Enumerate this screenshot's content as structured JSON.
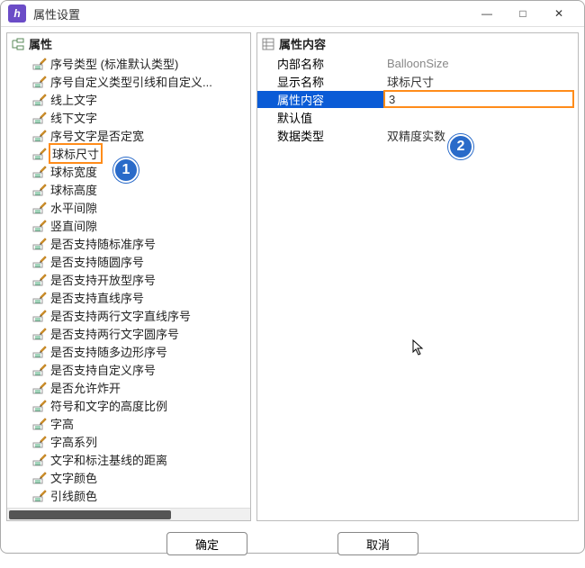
{
  "window": {
    "title": "属性设置",
    "minimize": "—",
    "maximize": "□",
    "close": "✕"
  },
  "left": {
    "header": "属性",
    "items": [
      {
        "label": "序号类型 (标准默认类型)"
      },
      {
        "label": "序号自定义类型引线和自定义..."
      },
      {
        "label": "线上文字"
      },
      {
        "label": "线下文字"
      },
      {
        "label": "序号文字是否定宽"
      },
      {
        "label": "球标尺寸",
        "highlighted": true
      },
      {
        "label": "球标宽度"
      },
      {
        "label": "球标高度"
      },
      {
        "label": "水平间隙"
      },
      {
        "label": "竖直间隙"
      },
      {
        "label": "是否支持随标准序号"
      },
      {
        "label": "是否支持随圆序号"
      },
      {
        "label": "是否支持开放型序号"
      },
      {
        "label": "是否支持直线序号"
      },
      {
        "label": "是否支持两行文字直线序号"
      },
      {
        "label": "是否支持两行文字圆序号"
      },
      {
        "label": "是否支持随多边形序号"
      },
      {
        "label": "是否支持自定义序号"
      },
      {
        "label": "是否允许炸开"
      },
      {
        "label": "符号和文字的高度比例"
      },
      {
        "label": "字高"
      },
      {
        "label": "字高系列"
      },
      {
        "label": "文字和标注基线的距离"
      },
      {
        "label": "文字颜色"
      },
      {
        "label": "引线颜色"
      }
    ]
  },
  "right": {
    "header": "属性内容",
    "rows": [
      {
        "key": "内部名称",
        "val": "BalloonSize",
        "grey": true
      },
      {
        "key": "显示名称",
        "val": "球标尺寸"
      },
      {
        "key": "属性内容",
        "val": "3",
        "selected": true,
        "editable": true
      },
      {
        "key": "默认值",
        "val": ""
      },
      {
        "key": "数据类型",
        "val": "双精度实数"
      }
    ]
  },
  "buttons": {
    "ok": "确定",
    "cancel": "取消"
  },
  "badges": {
    "b1": "1",
    "b2": "2"
  }
}
